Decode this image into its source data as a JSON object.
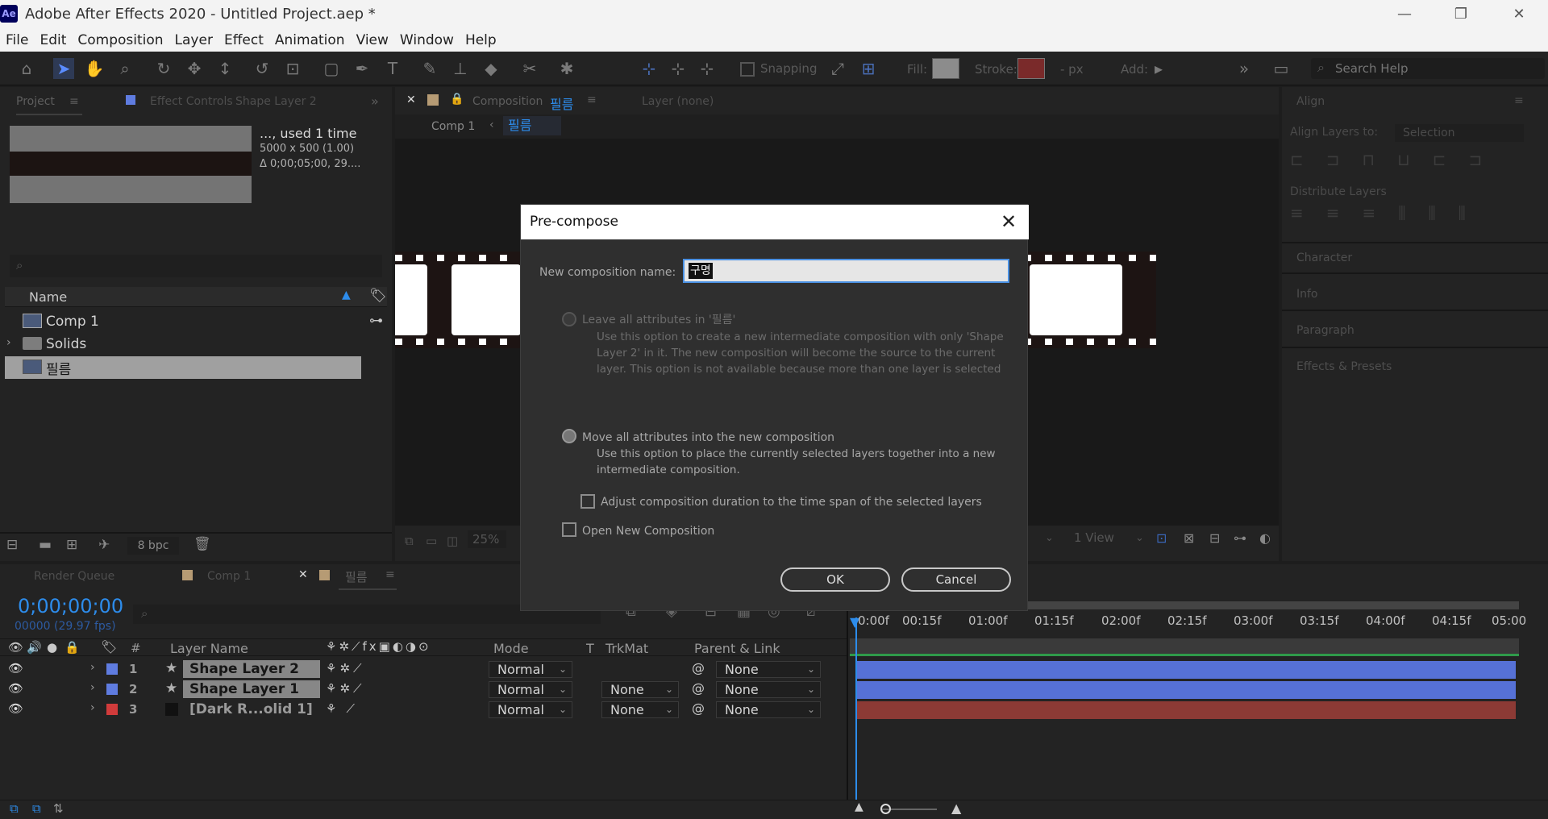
{
  "window": {
    "title": "Adobe After Effects 2020 - Untitled Project.aep *",
    "logo": "Ae"
  },
  "menu": [
    "File",
    "Edit",
    "Composition",
    "Layer",
    "Effect",
    "Animation",
    "View",
    "Window",
    "Help"
  ],
  "toolbar": {
    "snapping": "Snapping",
    "fill": "Fill:",
    "stroke": "Stroke:",
    "stroke_px": "- px",
    "add": "Add:",
    "search_placeholder": "Search Help"
  },
  "project": {
    "tab": "Project",
    "effect_controls_tab": "Effect Controls",
    "effect_controls_layer": "Shape Layer 2",
    "used": "..., used 1 time",
    "dims": "5000 x 500 (1.00)",
    "duration": "Δ 0;00;05;00, 29....",
    "column_name": "Name",
    "items": [
      {
        "name": "Comp 1"
      },
      {
        "name": "Solids"
      },
      {
        "name": "필름"
      }
    ],
    "bpc": "8 bpc"
  },
  "comp_panel": {
    "tab": "Composition",
    "comp_name": "필름",
    "layer_tab": "Layer (none)",
    "breadcrumb_comp1": "Comp 1",
    "breadcrumb_current": "필름",
    "zoom": "25%",
    "view": "1 View"
  },
  "right_panels": {
    "align": "Align",
    "align_to_label": "Align Layers to:",
    "align_to_value": "Selection",
    "distribute": "Distribute Layers",
    "character": "Character",
    "info": "Info",
    "paragraph": "Paragraph",
    "effects": "Effects & Presets"
  },
  "timeline": {
    "render_queue": "Render Queue",
    "comp1_tab": "Comp 1",
    "active_tab": "필름",
    "timecode": "0;00;00;00",
    "frames": "00000 (29.97 fps)",
    "columns": {
      "num": "#",
      "layer_name": "Layer Name",
      "mode": "Mode",
      "t": "T",
      "trkmat": "TrkMat",
      "parent": "Parent & Link"
    },
    "layers": [
      {
        "num": "1",
        "name": "Shape Layer 2",
        "mode": "Normal",
        "trkmat": "",
        "parent": "None",
        "color": "#5671d6"
      },
      {
        "num": "2",
        "name": "Shape Layer 1",
        "mode": "Normal",
        "trkmat": "None",
        "parent": "None",
        "color": "#5671d6"
      },
      {
        "num": "3",
        "name": "[Dark R...olid 1]",
        "mode": "Normal",
        "trkmat": "None",
        "parent": "None",
        "color": "#d13b3b"
      }
    ],
    "ruler": [
      "0:00f",
      "00:15f",
      "01:00f",
      "01:15f",
      "02:00f",
      "02:15f",
      "03:00f",
      "03:15f",
      "04:00f",
      "04:15f",
      "05:00"
    ]
  },
  "dialog": {
    "title": "Pre-compose",
    "name_label": "New composition name:",
    "name_value": "",
    "ime_text": "구명",
    "option1_label": "Leave all attributes in '필름'",
    "option1_desc": "Use this option to create a new intermediate composition with only 'Shape Layer 2' in it. The new composition will become the source to the current layer. This option is not available because more than one layer is selected",
    "option2_label": "Move all attributes into the new composition",
    "option2_desc": "Use this option to place the currently selected layers together into a new intermediate composition.",
    "adjust_label": "Adjust composition duration to the time span of the selected layers",
    "open_label": "Open New Composition",
    "ok": "OK",
    "cancel": "Cancel"
  }
}
